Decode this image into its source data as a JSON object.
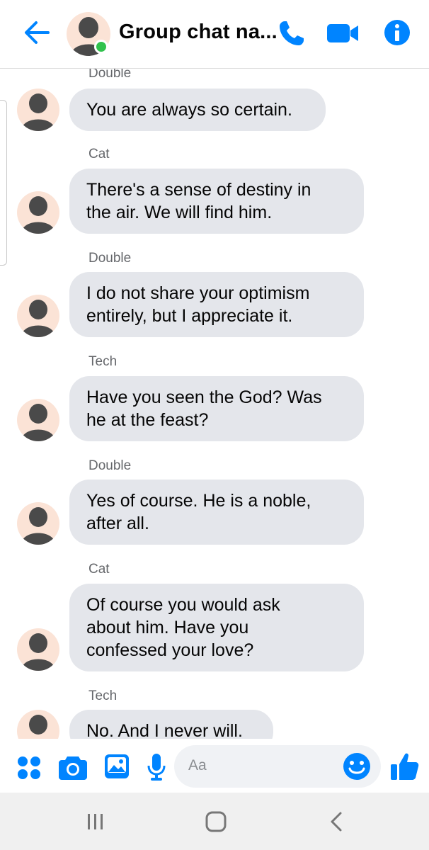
{
  "header": {
    "title": "Group chat na...",
    "icons": [
      "back-arrow-icon",
      "phone-icon",
      "video-camera-icon",
      "info-icon"
    ],
    "online": true
  },
  "messages": [
    {
      "sender": "Double",
      "text": "You are always so certain."
    },
    {
      "sender": "Cat",
      "text": "There's a sense of destiny in\nthe air. We will find him."
    },
    {
      "sender": "Double",
      "text": "I do not share your optimism\nentirely, but I appreciate it."
    },
    {
      "sender": "Tech",
      "text": "Have you seen the God? Was\nhe at the feast?"
    },
    {
      "sender": "Double",
      "text": "Yes of course. He is a noble,\nafter all."
    },
    {
      "sender": "Cat",
      "text": "Of course you would ask\nabout him. Have you\nconfessed your love?"
    },
    {
      "sender": "Tech",
      "text": "No. And I never will."
    }
  ],
  "composer": {
    "placeholder": "Aa",
    "icons": [
      "apps-icon",
      "camera-icon",
      "gallery-icon",
      "microphone-icon",
      "emoji-icon",
      "thumbs-up-icon"
    ]
  },
  "colors": {
    "accent": "#0084ff",
    "bubble": "#e4e6eb",
    "online": "#31c24d",
    "avatar_bg": "#fbe3d6",
    "avatar_figure": "#4a4a4a"
  },
  "system_nav": {
    "icons": [
      "recent-apps-icon",
      "home-icon",
      "back-icon"
    ]
  }
}
